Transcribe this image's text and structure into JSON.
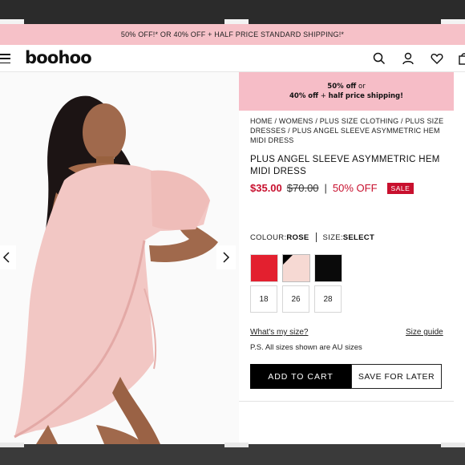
{
  "promo_bar": {
    "text": "50% OFF!* OR 40% OFF + HALF PRICE STANDARD SHIPPING!*"
  },
  "header": {
    "logo": "boohoo",
    "icons": [
      "menu-icon",
      "search-icon",
      "account-icon",
      "wishlist-heart-icon",
      "bag-icon"
    ]
  },
  "info_banner": {
    "line1_bold": "50% off",
    "line1_rest": " or",
    "line2_bold_a": "40% off",
    "line2_plus": " + ",
    "line2_bold_b": "half price shipping!"
  },
  "breadcrumb": {
    "items": [
      "HOME",
      "WOMENS",
      "PLUS SIZE CLOTHING",
      "PLUS SIZE DRESSES",
      "PLUS ANGEL SLEEVE ASYMMETRIC HEM MIDI DRESS"
    ],
    "separator": " / "
  },
  "product": {
    "title": "PLUS ANGEL SLEEVE ASYMMETRIC HEM MIDI DRESS",
    "price_now": "$35.00",
    "price_was": "$70.00",
    "price_sep": "|",
    "discount": "50% OFF",
    "badge": "SALE"
  },
  "attributes": {
    "colour_label": "COLOUR: ",
    "colour_value": "ROSE",
    "size_label": "SIZE: ",
    "size_value": "SELECT"
  },
  "swatches": [
    {
      "name": "red",
      "color": "#e3202f"
    },
    {
      "name": "rose",
      "color": "#f6d9d3"
    },
    {
      "name": "black",
      "color": "#0a0a0a"
    }
  ],
  "sizes": [
    "18",
    "26",
    "28"
  ],
  "links": {
    "whats_my_size": "What's my size?",
    "size_guide": "Size guide"
  },
  "au_note": "P.S. All sizes shown are AU sizes",
  "buttons": {
    "add_to_cart": "ADD TO CART",
    "save_for_later": "SAVE FOR LATER"
  },
  "colors": {
    "promo_pink": "#f6c1c8",
    "sale_red": "#c8102e",
    "dress_pink": "#f2c7c4"
  }
}
